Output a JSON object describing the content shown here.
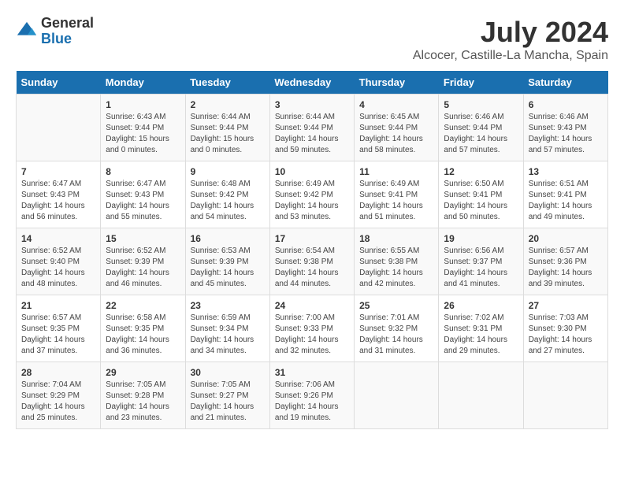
{
  "header": {
    "logo_general": "General",
    "logo_blue": "Blue",
    "title": "July 2024",
    "subtitle": "Alcocer, Castille-La Mancha, Spain"
  },
  "weekdays": [
    "Sunday",
    "Monday",
    "Tuesday",
    "Wednesday",
    "Thursday",
    "Friday",
    "Saturday"
  ],
  "weeks": [
    [
      {
        "day": "",
        "info": ""
      },
      {
        "day": "1",
        "info": "Sunrise: 6:43 AM\nSunset: 9:44 PM\nDaylight: 15 hours\nand 0 minutes."
      },
      {
        "day": "2",
        "info": "Sunrise: 6:44 AM\nSunset: 9:44 PM\nDaylight: 15 hours\nand 0 minutes."
      },
      {
        "day": "3",
        "info": "Sunrise: 6:44 AM\nSunset: 9:44 PM\nDaylight: 14 hours\nand 59 minutes."
      },
      {
        "day": "4",
        "info": "Sunrise: 6:45 AM\nSunset: 9:44 PM\nDaylight: 14 hours\nand 58 minutes."
      },
      {
        "day": "5",
        "info": "Sunrise: 6:46 AM\nSunset: 9:44 PM\nDaylight: 14 hours\nand 57 minutes."
      },
      {
        "day": "6",
        "info": "Sunrise: 6:46 AM\nSunset: 9:43 PM\nDaylight: 14 hours\nand 57 minutes."
      }
    ],
    [
      {
        "day": "7",
        "info": "Sunrise: 6:47 AM\nSunset: 9:43 PM\nDaylight: 14 hours\nand 56 minutes."
      },
      {
        "day": "8",
        "info": "Sunrise: 6:47 AM\nSunset: 9:43 PM\nDaylight: 14 hours\nand 55 minutes."
      },
      {
        "day": "9",
        "info": "Sunrise: 6:48 AM\nSunset: 9:42 PM\nDaylight: 14 hours\nand 54 minutes."
      },
      {
        "day": "10",
        "info": "Sunrise: 6:49 AM\nSunset: 9:42 PM\nDaylight: 14 hours\nand 53 minutes."
      },
      {
        "day": "11",
        "info": "Sunrise: 6:49 AM\nSunset: 9:41 PM\nDaylight: 14 hours\nand 51 minutes."
      },
      {
        "day": "12",
        "info": "Sunrise: 6:50 AM\nSunset: 9:41 PM\nDaylight: 14 hours\nand 50 minutes."
      },
      {
        "day": "13",
        "info": "Sunrise: 6:51 AM\nSunset: 9:41 PM\nDaylight: 14 hours\nand 49 minutes."
      }
    ],
    [
      {
        "day": "14",
        "info": "Sunrise: 6:52 AM\nSunset: 9:40 PM\nDaylight: 14 hours\nand 48 minutes."
      },
      {
        "day": "15",
        "info": "Sunrise: 6:52 AM\nSunset: 9:39 PM\nDaylight: 14 hours\nand 46 minutes."
      },
      {
        "day": "16",
        "info": "Sunrise: 6:53 AM\nSunset: 9:39 PM\nDaylight: 14 hours\nand 45 minutes."
      },
      {
        "day": "17",
        "info": "Sunrise: 6:54 AM\nSunset: 9:38 PM\nDaylight: 14 hours\nand 44 minutes."
      },
      {
        "day": "18",
        "info": "Sunrise: 6:55 AM\nSunset: 9:38 PM\nDaylight: 14 hours\nand 42 minutes."
      },
      {
        "day": "19",
        "info": "Sunrise: 6:56 AM\nSunset: 9:37 PM\nDaylight: 14 hours\nand 41 minutes."
      },
      {
        "day": "20",
        "info": "Sunrise: 6:57 AM\nSunset: 9:36 PM\nDaylight: 14 hours\nand 39 minutes."
      }
    ],
    [
      {
        "day": "21",
        "info": "Sunrise: 6:57 AM\nSunset: 9:35 PM\nDaylight: 14 hours\nand 37 minutes."
      },
      {
        "day": "22",
        "info": "Sunrise: 6:58 AM\nSunset: 9:35 PM\nDaylight: 14 hours\nand 36 minutes."
      },
      {
        "day": "23",
        "info": "Sunrise: 6:59 AM\nSunset: 9:34 PM\nDaylight: 14 hours\nand 34 minutes."
      },
      {
        "day": "24",
        "info": "Sunrise: 7:00 AM\nSunset: 9:33 PM\nDaylight: 14 hours\nand 32 minutes."
      },
      {
        "day": "25",
        "info": "Sunrise: 7:01 AM\nSunset: 9:32 PM\nDaylight: 14 hours\nand 31 minutes."
      },
      {
        "day": "26",
        "info": "Sunrise: 7:02 AM\nSunset: 9:31 PM\nDaylight: 14 hours\nand 29 minutes."
      },
      {
        "day": "27",
        "info": "Sunrise: 7:03 AM\nSunset: 9:30 PM\nDaylight: 14 hours\nand 27 minutes."
      }
    ],
    [
      {
        "day": "28",
        "info": "Sunrise: 7:04 AM\nSunset: 9:29 PM\nDaylight: 14 hours\nand 25 minutes."
      },
      {
        "day": "29",
        "info": "Sunrise: 7:05 AM\nSunset: 9:28 PM\nDaylight: 14 hours\nand 23 minutes."
      },
      {
        "day": "30",
        "info": "Sunrise: 7:05 AM\nSunset: 9:27 PM\nDaylight: 14 hours\nand 21 minutes."
      },
      {
        "day": "31",
        "info": "Sunrise: 7:06 AM\nSunset: 9:26 PM\nDaylight: 14 hours\nand 19 minutes."
      },
      {
        "day": "",
        "info": ""
      },
      {
        "day": "",
        "info": ""
      },
      {
        "day": "",
        "info": ""
      }
    ]
  ]
}
